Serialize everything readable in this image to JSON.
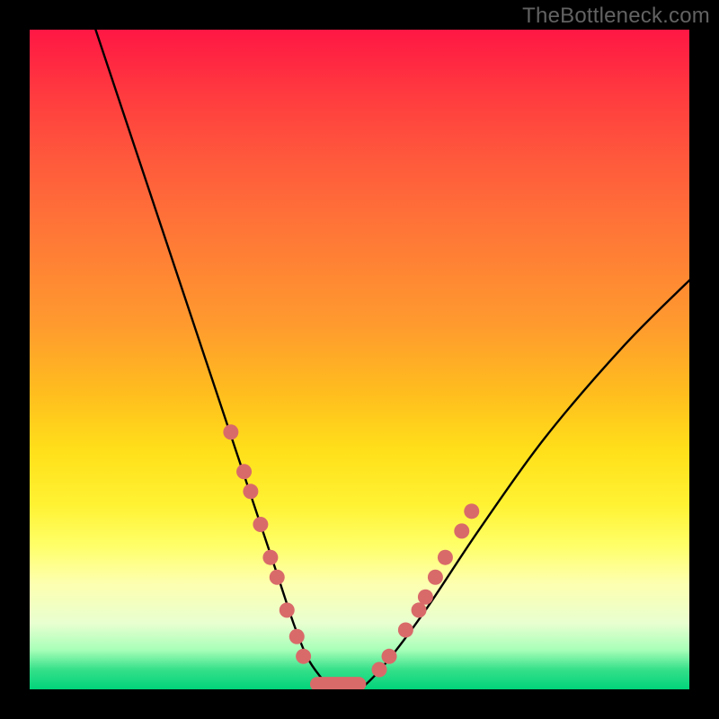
{
  "watermark": "TheBottleneck.com",
  "chart_data": {
    "type": "line",
    "title": "",
    "xlabel": "",
    "ylabel": "",
    "xlim": [
      0,
      100
    ],
    "ylim": [
      0,
      100
    ],
    "series": [
      {
        "name": "curve",
        "x": [
          10,
          14,
          18,
          22,
          26,
          30,
          32,
          34,
          36,
          38,
          40,
          42,
          44,
          46,
          48,
          50,
          54,
          60,
          68,
          78,
          90,
          100
        ],
        "y": [
          100,
          88,
          76,
          64,
          52,
          40,
          34,
          28,
          22,
          16,
          10,
          5,
          2,
          0,
          0,
          0,
          4,
          12,
          24,
          38,
          52,
          62
        ]
      }
    ],
    "markers": {
      "name": "highlight-points",
      "color": "#d96a6a",
      "points": [
        {
          "x": 30.5,
          "y": 39
        },
        {
          "x": 32.5,
          "y": 33
        },
        {
          "x": 33.5,
          "y": 30
        },
        {
          "x": 35.0,
          "y": 25
        },
        {
          "x": 36.5,
          "y": 20
        },
        {
          "x": 37.5,
          "y": 17
        },
        {
          "x": 39.0,
          "y": 12
        },
        {
          "x": 40.5,
          "y": 8
        },
        {
          "x": 41.5,
          "y": 5
        },
        {
          "x": 53.0,
          "y": 3
        },
        {
          "x": 54.5,
          "y": 5
        },
        {
          "x": 57.0,
          "y": 9
        },
        {
          "x": 59.0,
          "y": 12
        },
        {
          "x": 60.0,
          "y": 14
        },
        {
          "x": 61.5,
          "y": 17
        },
        {
          "x": 63.0,
          "y": 20
        },
        {
          "x": 65.5,
          "y": 24
        },
        {
          "x": 67.0,
          "y": 27
        }
      ]
    },
    "flat_bar": {
      "name": "bottom-bar",
      "color": "#d96a6a",
      "x_start": 42.5,
      "x_end": 51.0,
      "y": 0.8
    },
    "gradient_stops": [
      {
        "pos": 0,
        "color": "#ff1744"
      },
      {
        "pos": 20,
        "color": "#ff5a3c"
      },
      {
        "pos": 45,
        "color": "#ff9b2e"
      },
      {
        "pos": 64,
        "color": "#ffe01a"
      },
      {
        "pos": 78,
        "color": "#ffff66"
      },
      {
        "pos": 90,
        "color": "#e8ffd0"
      },
      {
        "pos": 100,
        "color": "#00d37a"
      }
    ]
  }
}
